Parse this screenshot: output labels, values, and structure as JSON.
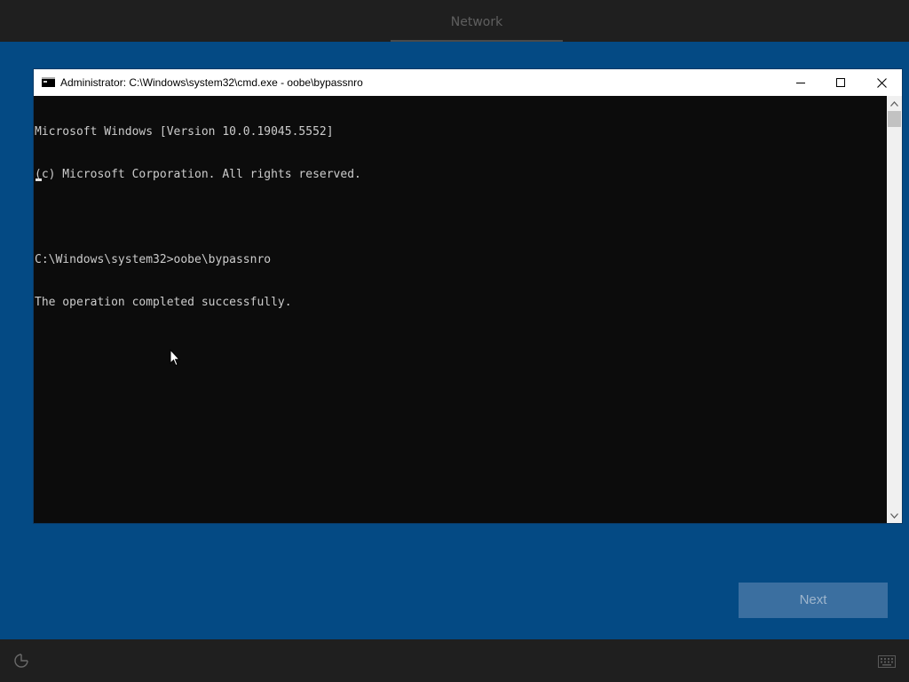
{
  "oobe": {
    "current_step": "Network",
    "next_label": "Next",
    "icons": {
      "accessibility": "accessibility-icon",
      "keyboard": "keyboard-icon"
    }
  },
  "cmd_window": {
    "title": "Administrator: C:\\Windows\\system32\\cmd.exe - oobe\\bypassnro",
    "controls": {
      "minimize": "minimize-icon",
      "maximize": "maximize-icon",
      "close": "close-icon"
    },
    "lines": [
      "Microsoft Windows [Version 10.0.19045.5552]",
      "(c) Microsoft Corporation. All rights reserved.",
      "",
      "C:\\Windows\\system32>oobe\\bypassnro",
      "The operation completed successfully."
    ]
  },
  "colors": {
    "background": "#044a84",
    "cmd_background": "#0c0c0c",
    "cmd_text": "#cccccc",
    "next_button": "#3b6fa0"
  }
}
